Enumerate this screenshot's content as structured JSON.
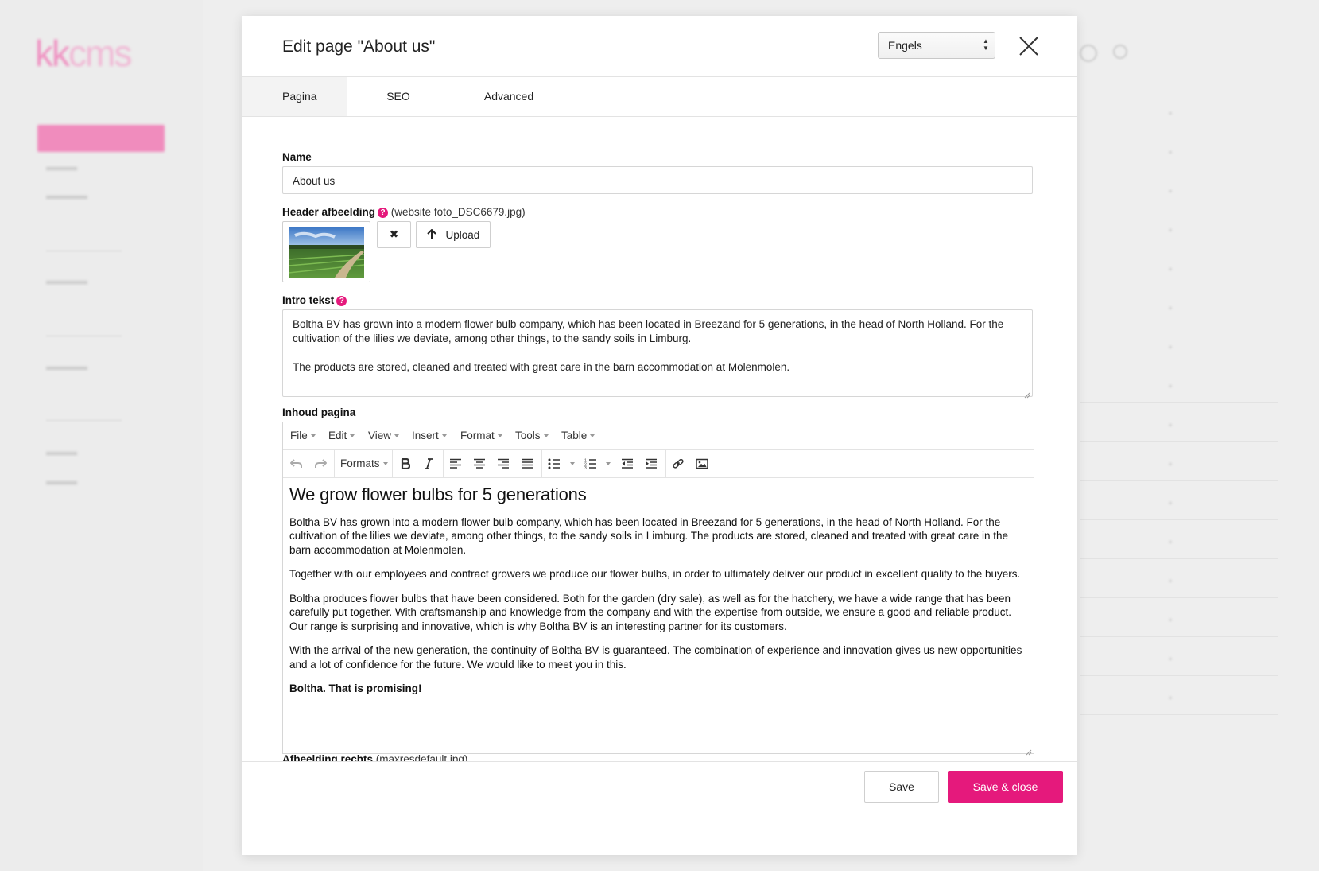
{
  "background": {
    "brand_color": "#e5197c"
  },
  "modal": {
    "title": "Edit page \"About us\"",
    "language": {
      "selected": "Engels"
    },
    "tabs": [
      {
        "label": "Pagina",
        "active": true
      },
      {
        "label": "SEO",
        "active": false
      },
      {
        "label": "Advanced",
        "active": false
      }
    ],
    "fields": {
      "name": {
        "label": "Name",
        "value": "About us"
      },
      "header_image": {
        "label": "Header afbeelding",
        "filename": "(website foto_DSC6679.jpg)",
        "remove_icon": "✖",
        "upload_label": "Upload"
      },
      "intro": {
        "label": "Intro tekst",
        "paragraphs": [
          "Boltha BV has grown into a modern flower bulb company, which has been located in Breezand for 5 generations, in the head of North Holland. For the cultivation of the lilies we deviate, among other things, to the sandy soils in Limburg.",
          "The products are stored, cleaned and treated with great care in the barn accommodation at Molenmolen."
        ]
      },
      "content": {
        "label": "Inhoud pagina",
        "menu": [
          "File",
          "Edit",
          "View",
          "Insert",
          "Format",
          "Tools",
          "Table"
        ],
        "formats_label": "Formats",
        "heading": "We grow flower bulbs for 5 generations",
        "paragraphs": [
          "Boltha BV has grown into a modern flower bulb company, which has been located in Breezand for 5 generations, in the head of North Holland. For the cultivation of the lilies we deviate, among other things, to the sandy soils in Limburg. The products are stored, cleaned and treated with great care in the barn accommodation at Molenmolen.",
          "Together with our employees and contract growers we produce our flower bulbs, in order to ultimately deliver our product in excellent quality to the buyers.",
          "Boltha produces flower bulbs that have been considered. Both for the garden (dry sale), as well as for the hatchery, we have a wide range that has been carefully put together. With craftsmanship and knowledge from the company and with the expertise from outside, we ensure a good and reliable product. Our range is surprising and innovative, which is why Boltha BV is an interesting partner for its customers.",
          "With the arrival of the new generation, the continuity of Boltha BV is guaranteed. The combination of experience and innovation gives us new opportunities and a lot of confidence for the future. We would like to meet you in this."
        ],
        "closing": "Boltha. That is promising!"
      },
      "right_image": {
        "label": "Afbeelding rechts",
        "filename": "(maxresdefault.jpg)"
      }
    },
    "footer": {
      "save_label": "Save",
      "save_close_label": "Save & close"
    }
  }
}
